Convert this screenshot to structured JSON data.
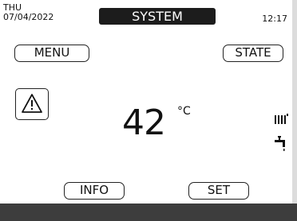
{
  "header": {
    "day": "THU",
    "date": "07/04/2022",
    "title": "SYSTEM",
    "time": "12:17"
  },
  "buttons": {
    "menu": "MENU",
    "state": "STATE",
    "info": "INFO",
    "set": "SET"
  },
  "main": {
    "temperature": "42",
    "unit": "°C"
  },
  "icons": {
    "alarm": "warning-triangle-icon",
    "heating": "radiator-icon",
    "hot_water": "tap-icon"
  },
  "colors": {
    "title_bar": "#1c1c1c",
    "bottom_bar": "#3d3d3d",
    "screen": "#ffffff"
  }
}
